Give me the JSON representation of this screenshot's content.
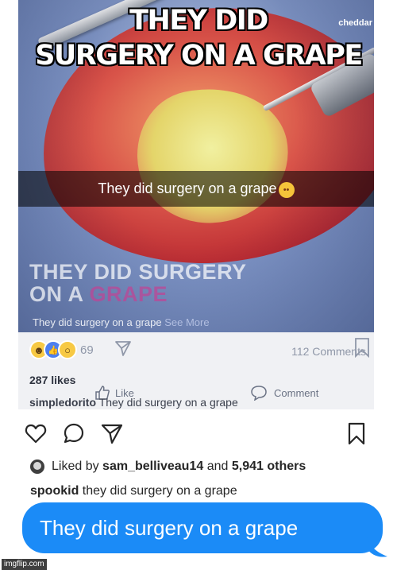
{
  "meme": {
    "caption_line1": "THEY DID",
    "caption_line2": "SURGERY ON A GRAPE"
  },
  "photo": {
    "brand_logo": "cheddar",
    "snap_caption": "They did surgery on a grape",
    "snap_emoji": "flushed-face-emoji"
  },
  "facebook_post": {
    "title_part1": "THEY DID",
    "title_part2": "SURGERY",
    "title_part3": "ON A",
    "title_part4": "GRAPE",
    "description": "They did surgery on a grape",
    "see_more": "See More",
    "reaction_count": "69",
    "comments_count": "112 Comments",
    "like_label": "Like",
    "comment_label": "Comment"
  },
  "faded_instagram": {
    "likes": "287 likes",
    "caption_user": "simpledorito",
    "caption_text": "They did surgery on a grape"
  },
  "instagram": {
    "liked_by_prefix": "Liked by",
    "liked_by_user": "sam_belliveau14",
    "liked_by_middle": "and",
    "liked_by_others": "5,941 others",
    "caption_user": "spookid",
    "caption_text": "they did surgery on a grape"
  },
  "imessage": {
    "text": "They did surgery on a grape",
    "bubble_color": "#1b8bf7"
  },
  "watermark": "imgflip.com"
}
